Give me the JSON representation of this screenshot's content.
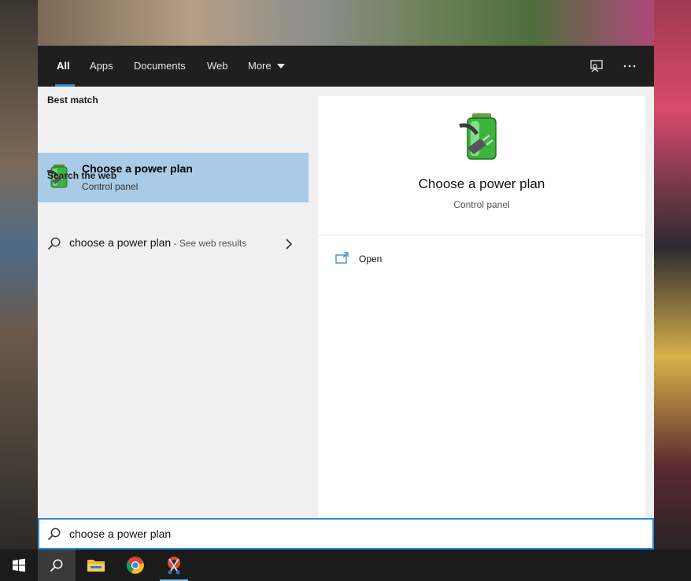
{
  "tabs": [
    {
      "label": "All"
    },
    {
      "label": "Apps"
    },
    {
      "label": "Documents"
    },
    {
      "label": "Web"
    },
    {
      "label": "More"
    }
  ],
  "left": {
    "best_match_heading": "Best match",
    "best_match": {
      "title": "Choose a power plan",
      "subtitle": "Control panel"
    },
    "search_web_heading": "Search the web",
    "web_result": {
      "query": "choose a power plan",
      "hint": " - See web results"
    }
  },
  "right": {
    "title": "Choose a power plan",
    "subtitle": "Control panel",
    "open_label": "Open"
  },
  "search": {
    "value": "choose a power plan"
  },
  "colors": {
    "accent": "#2a8bd6",
    "selection": "#a8cbe8",
    "topbar": "#1f1f1f",
    "taskbar": "#1b1b1b"
  },
  "icons": {
    "feedback": "feedback-icon",
    "more_options": "ellipsis-icon",
    "battery": "battery-plug-icon",
    "open": "open-window-icon",
    "search": "search-icon",
    "windows": "windows-logo-icon",
    "explorer": "file-explorer-icon",
    "chrome": "chrome-icon",
    "snip": "snip-sketch-icon"
  }
}
